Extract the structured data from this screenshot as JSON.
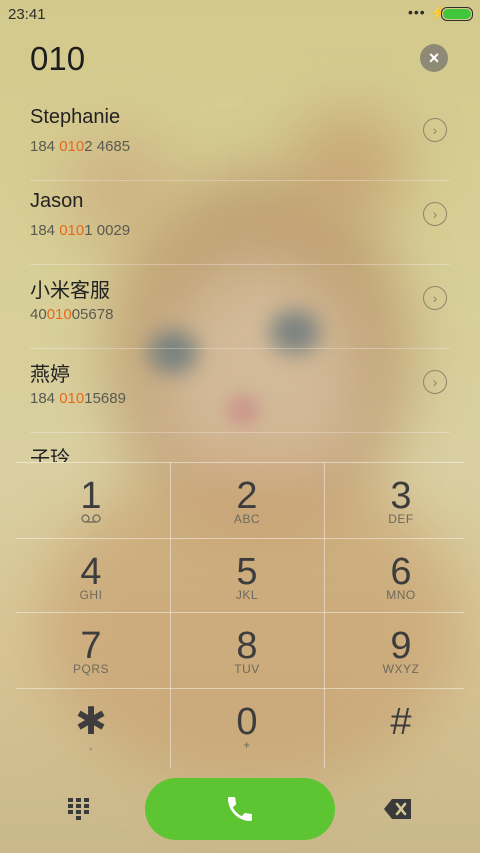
{
  "status_bar": {
    "time": "23:41",
    "signal": "•••",
    "charging": "⚡"
  },
  "search": {
    "query": "010",
    "clear_icon": "×"
  },
  "contacts": [
    {
      "name": "Stephanie",
      "num_pre": "184 ",
      "num_hl": "010",
      "num_post": "2 4685"
    },
    {
      "name": "Jason",
      "num_pre": "184 ",
      "num_hl": "010",
      "num_post": "1 0029"
    },
    {
      "name": "小米客服",
      "num_pre": "40",
      "num_hl": "010",
      "num_post": "05678"
    },
    {
      "name": "燕婷",
      "num_pre": "184 ",
      "num_hl": "010",
      "num_post": "15689"
    },
    {
      "name": "子玲",
      "num_pre": "",
      "num_hl": "",
      "num_post": ""
    }
  ],
  "keypad": {
    "keys": [
      {
        "digit": "1",
        "sub": ""
      },
      {
        "digit": "2",
        "sub": "ABC"
      },
      {
        "digit": "3",
        "sub": "DEF"
      },
      {
        "digit": "4",
        "sub": "GHI"
      },
      {
        "digit": "5",
        "sub": "JKL"
      },
      {
        "digit": "6",
        "sub": "MNO"
      },
      {
        "digit": "7",
        "sub": "PQRS"
      },
      {
        "digit": "8",
        "sub": "TUV"
      },
      {
        "digit": "9",
        "sub": "WXYZ"
      },
      {
        "digit": "✱",
        "sub": ","
      },
      {
        "digit": "0",
        "sub": "+"
      },
      {
        "digit": "#",
        "sub": ""
      }
    ]
  },
  "colors": {
    "call_green": "#5dc531",
    "highlight": "#e56a1e",
    "battery_green": "#3fc63a"
  }
}
